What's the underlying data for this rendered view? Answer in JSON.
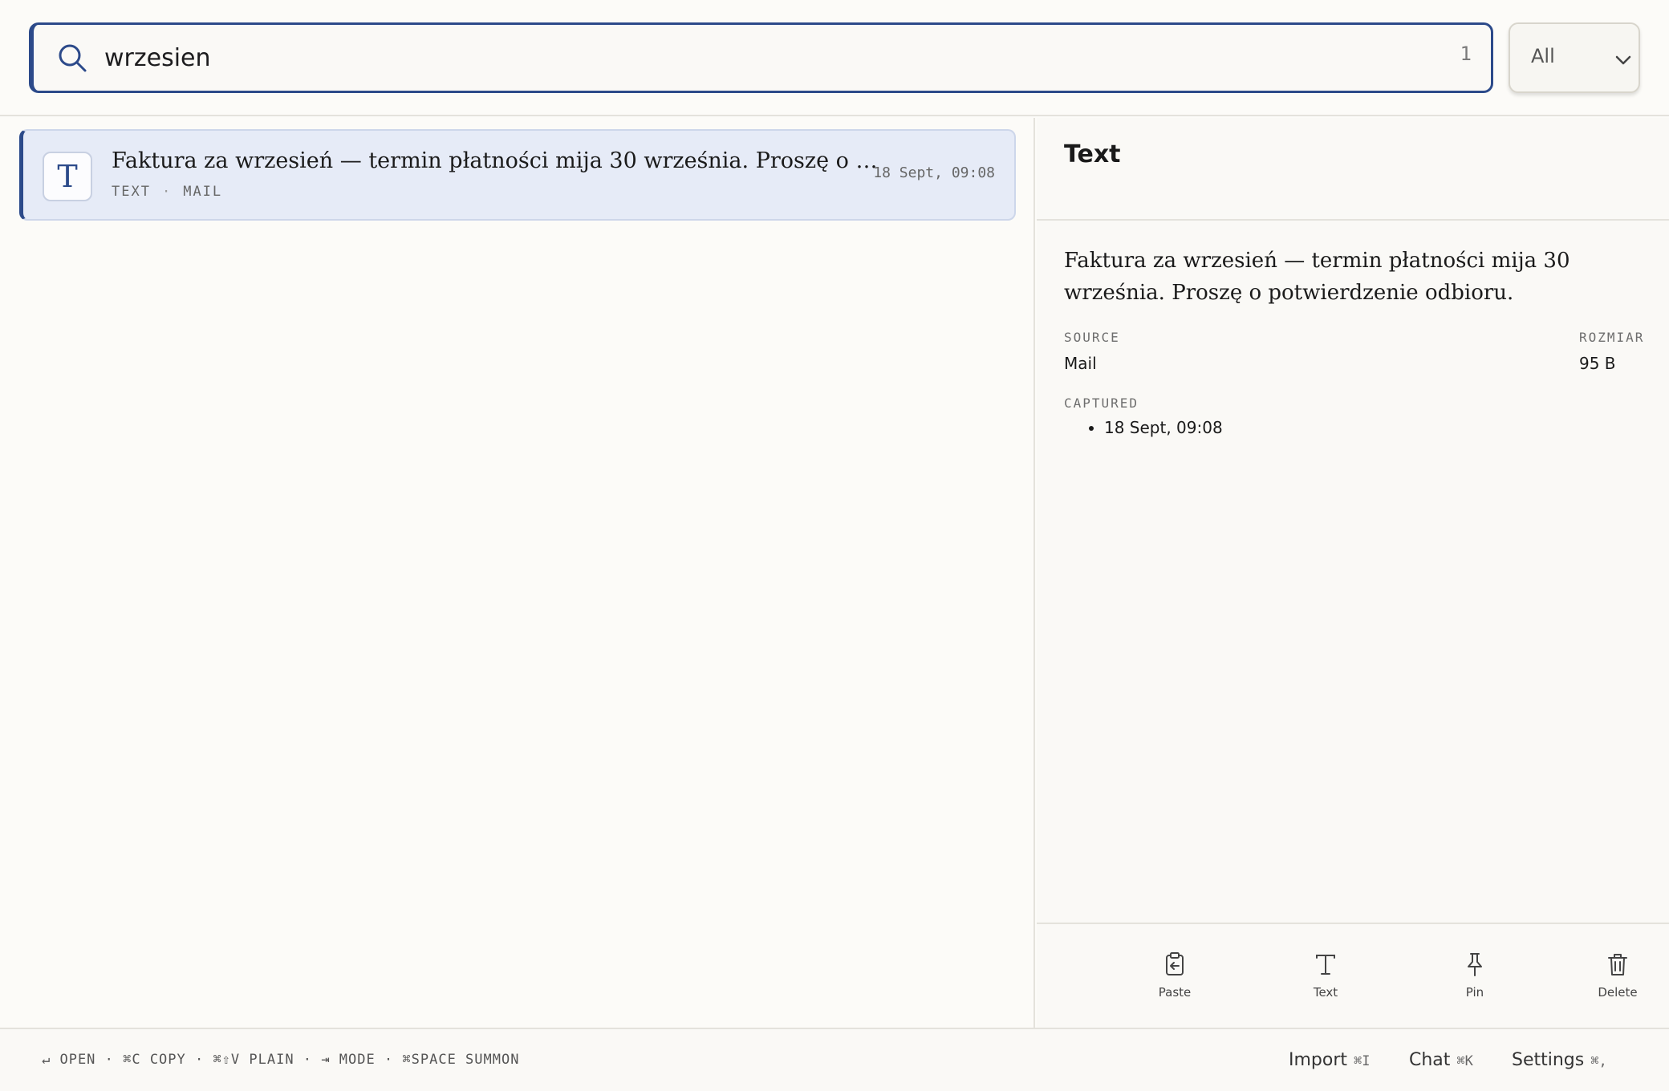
{
  "search": {
    "query": "wrzesien",
    "result_count": "1",
    "filter_value": "All"
  },
  "results": [
    {
      "icon_glyph": "T",
      "title": "Faktura za wrzesień — termin płatności mija 30 września. Proszę o pot...",
      "type": "TEXT",
      "source": "MAIL",
      "time": "18 Sept, 09:08"
    }
  ],
  "detail": {
    "title": "Text",
    "body": "Faktura za wrzesień — termin płatności mija 30 września. Proszę o potwierdzenie odbioru.",
    "source_label": "SOURCE",
    "source_value": "Mail",
    "size_label": "ROZMIAR",
    "size_value": "95 B",
    "captured_label": "CAPTURED",
    "captured_value": "18 Sept, 09:08"
  },
  "actions": {
    "paste": "Paste",
    "text": "Text",
    "pin": "Pin",
    "delete": "Delete"
  },
  "footer": {
    "shortcuts": "↵ OPEN · ⌘C COPY · ⌘⇧V PLAIN · ⇥ MODE · ⌘SPACE SUMMON",
    "import_label": "Import",
    "import_kbd": "⌘I",
    "chat_label": "Chat",
    "chat_kbd": "⌘K",
    "settings_label": "Settings",
    "settings_kbd": "⌘,"
  },
  "colors": {
    "accent": "#2c4a8a",
    "selected_row": "#e6ebf7",
    "background": "#fcfbf8"
  }
}
